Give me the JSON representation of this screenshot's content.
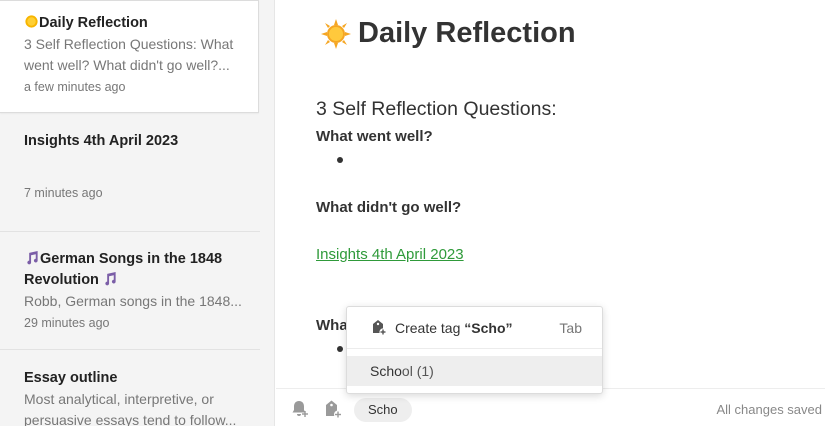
{
  "sidebar": {
    "notes": [
      {
        "title": "Daily Reflection",
        "snippet": " 3 Self Reflection Questions: What went well? What didn't go well?...",
        "time": "a few minutes ago"
      },
      {
        "title": "Insights 4th April 2023",
        "snippet": "",
        "time": "7 minutes ago"
      },
      {
        "title_part1": "German Songs in the 1848",
        "title_part2": "Revolution",
        "snippet": "Robb, German songs in the 1848...",
        "time": "29 minutes ago"
      },
      {
        "title": "Essay outline",
        "snippet": "Most analytical, interpretive, or persuasive essays tend to follow..."
      }
    ]
  },
  "editor": {
    "title": "Daily Reflection",
    "heading": "3 Self Reflection Questions:",
    "q1": "What went well?",
    "q2": "What didn't go well?",
    "link": "Insights 4th April 2023",
    "q3_partial": "Wha"
  },
  "tag_popup": {
    "create_prefix": "Create tag",
    "query": "“Scho”",
    "shortcut": "Tab",
    "suggestion_match": "Scho",
    "suggestion_rest": "ol",
    "suggestion_count": "(1)"
  },
  "bottombar": {
    "tag_input": "Scho",
    "status": "All changes saved"
  },
  "colors": {
    "link": "#2f9a3a",
    "sun": "#f5a623",
    "note_icon": "#7b5ea7"
  }
}
